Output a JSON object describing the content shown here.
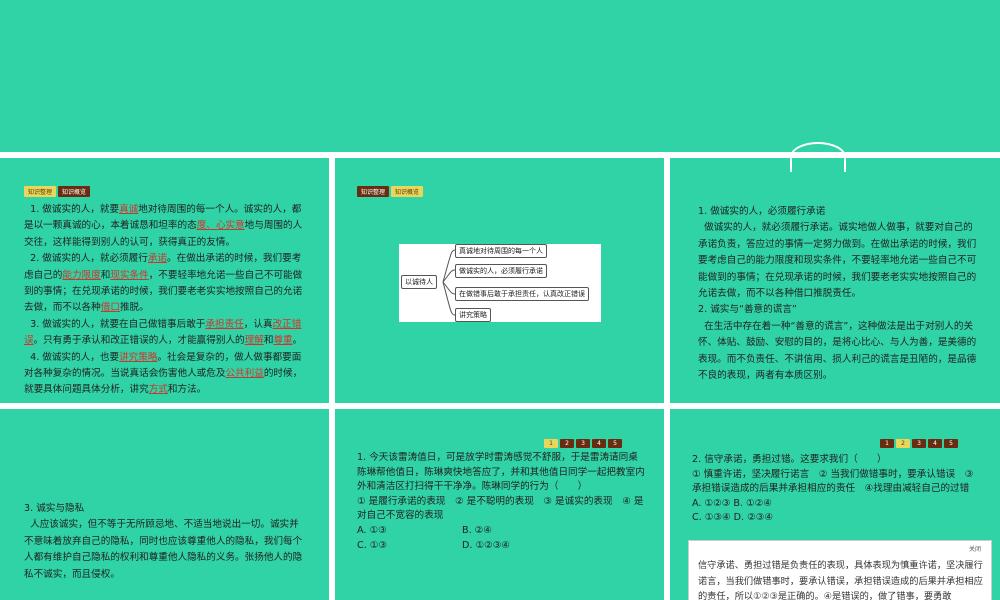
{
  "slide1": {
    "tabs": [
      "知识整理",
      "知识概览"
    ],
    "p1_pre": "1. 做诚实的人，就要",
    "p1_a1": "真诚",
    "p1_mid": "地对待周围的每一个人。诚实的人，都是以一颗真诚的心，本着诚恳和坦率的态",
    "p1_a2": "度、心实意",
    "p1_post": "地与周围的人交往，这样能得到别人的认可，获得真正的友情。",
    "p2_pre": "2. 做诚实的人，就必须履行",
    "p2_a1": "承诺",
    "p2_mid1": "。在做出承诺的时候，我们要考虑自己的",
    "p2_a2": "能力限度",
    "p2_and": "和",
    "p2_a3": "现实条件",
    "p2_mid2": "，不要轻率地允诺一些自己不可能做到的事情；在兑现承诺的时候，我们要老老实实地按照自己的允诺去做，而不以各种",
    "p2_a4": "借口",
    "p2_post": "推脱。",
    "p3_pre": "3. 做诚实的人，就要在自己做错事后敢于",
    "p3_a1": "承担责任",
    "p3_mid1": "，认真",
    "p3_a2": "改正错误",
    "p3_mid2": "。只有勇于承认和改正错误的人，才能赢得别人的",
    "p3_a3": "理解",
    "p3_and": "和",
    "p3_a4": "尊重",
    "p3_post": "。",
    "p4_pre": "4. 做诚实的人，也要",
    "p4_a1": "讲究策略",
    "p4_mid1": "。社会是复杂的，做人做事都要面对各种复杂的情况。当说真话会伤害他人或危及",
    "p4_a2": "公共利益",
    "p4_mid2": "的时候，就要具体问题具体分析，讲究",
    "p4_a3": "方式",
    "p4_post": "和方法。"
  },
  "slide2": {
    "tabs": [
      "知识整理",
      "知识概览"
    ],
    "mindmap": {
      "root": "以诚待人",
      "branches": [
        "真诚地对待周围的每一个人",
        "做诚实的人，必须履行承诺",
        "在做错事后敢于承担责任，认真改正错误",
        "讲究策略"
      ]
    }
  },
  "slide3": {
    "h1": "1. 做诚实的人，必须履行承诺",
    "t1": "做诚实的人，就必须履行承诺。诚实地做人做事，就要对自己的承诺负责，答应过的事情一定努力做到。在做出承诺的时候，我们要考虑自己的能力限度和现实条件，不要轻率地允诺一些自己不可能做到的事情；在兑现承诺的时候，我们要老老实实地按照自己的允诺去做，而不以各种借口推脱责任。",
    "h2": "2. 诚实与“善意的谎言”",
    "t2": "在生活中存在着一种“善意的谎言”，这种做法是出于对别人的关怀、体贴、鼓励、安慰的目的，是将心比心、与人为善，是美德的表现。而不负责任、不讲信用、损人利己的谎言是丑陋的，是品德不良的表现，两者有本质区别。"
  },
  "slide4": {
    "h3": "3. 诚实与隐私",
    "t3": "人应该诚实，但不等于无所顾忌地、不适当地说出一切。诚实并不意味着放弃自己的隐私，同时也应该尊重他人的隐私，我们每个人都有维护自己隐私的权利和尊重他人隐私的义务。张扬他人的隐私不诚实，而且侵权。"
  },
  "slide5": {
    "pages": [
      "1",
      "2",
      "3",
      "4",
      "5"
    ],
    "active_page": 1,
    "question": "1. 今天该雷涛值日，可是放学时雷涛感觉不舒服，于是雷涛请同桌陈琳帮他值日，陈琳爽快地答应了，并和其他值日同学一起把教室内外和清洁区打扫得干干净净。陈琳同学的行为（　　）",
    "stmts": "① 是履行承诺的表现　② 是不聪明的表现　③ 是诚实的表现　④ 是对自己不宽容的表现",
    "optA": "A. ①③",
    "optB": "B. ②④",
    "optC": "C. ①③",
    "optD": "D. ①②③④"
  },
  "slide6": {
    "pages": [
      "1",
      "2",
      "3",
      "4",
      "5"
    ],
    "active_page": 2,
    "question": "2. 信守承诺，勇担过错。这要求我们（　　）",
    "stmts": "① 慎重许诺，坚决履行诺言　② 当我们做错事时，要承认错误　③承担错误造成的后果并承担相应的责任　④找理由减轻自己的过错",
    "optAB": "A. ①②③  B. ①②④",
    "optCD": "C. ①③④  D. ②③④",
    "close": "关闭",
    "explain": "信守承诺、勇担过错是负责任的表现，具体表现为慎重许诺，坚决履行诺言，当我们做错事时，要承认错误，承担错误造成的后果并承担相应的责任，所以①②③是正确的。④是错误的，做了错事，要勇敢"
  }
}
